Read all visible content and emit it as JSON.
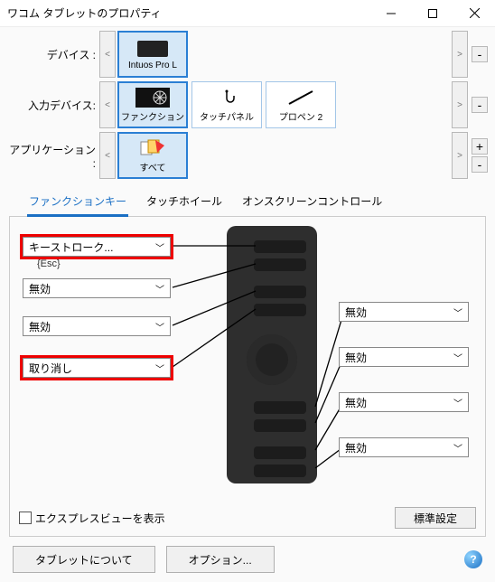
{
  "window": {
    "title": "ワコム タブレットのプロパティ"
  },
  "rows": {
    "device_label": "デバイス :",
    "input_label": "入力デバイス:",
    "app_label": "アプリケーション :",
    "device": {
      "name": "Intuos Pro L"
    },
    "inputs": [
      {
        "name": "ファンクション"
      },
      {
        "name": "タッチパネル"
      },
      {
        "name": "プロペン 2"
      }
    ],
    "apps": [
      {
        "name": "すべて"
      }
    ]
  },
  "tabs": {
    "functionkey": "ファンクションキー",
    "touchwheel": "タッチホイール",
    "onscreen": "オンスクリーンコントロール"
  },
  "left_keys": [
    {
      "label": "キーストローク...",
      "annotation": "{Esc}",
      "highlight": true
    },
    {
      "label": "無効",
      "highlight": false
    },
    {
      "label": "無効",
      "highlight": false
    },
    {
      "label": "取り消し",
      "highlight": true
    }
  ],
  "right_keys": [
    {
      "label": "無効"
    },
    {
      "label": "無効"
    },
    {
      "label": "無効"
    },
    {
      "label": "無効"
    }
  ],
  "express_view": "エクスプレスビューを表示",
  "default_settings": "標準設定",
  "footer": {
    "about": "タブレットについて",
    "options": "オプション..."
  }
}
